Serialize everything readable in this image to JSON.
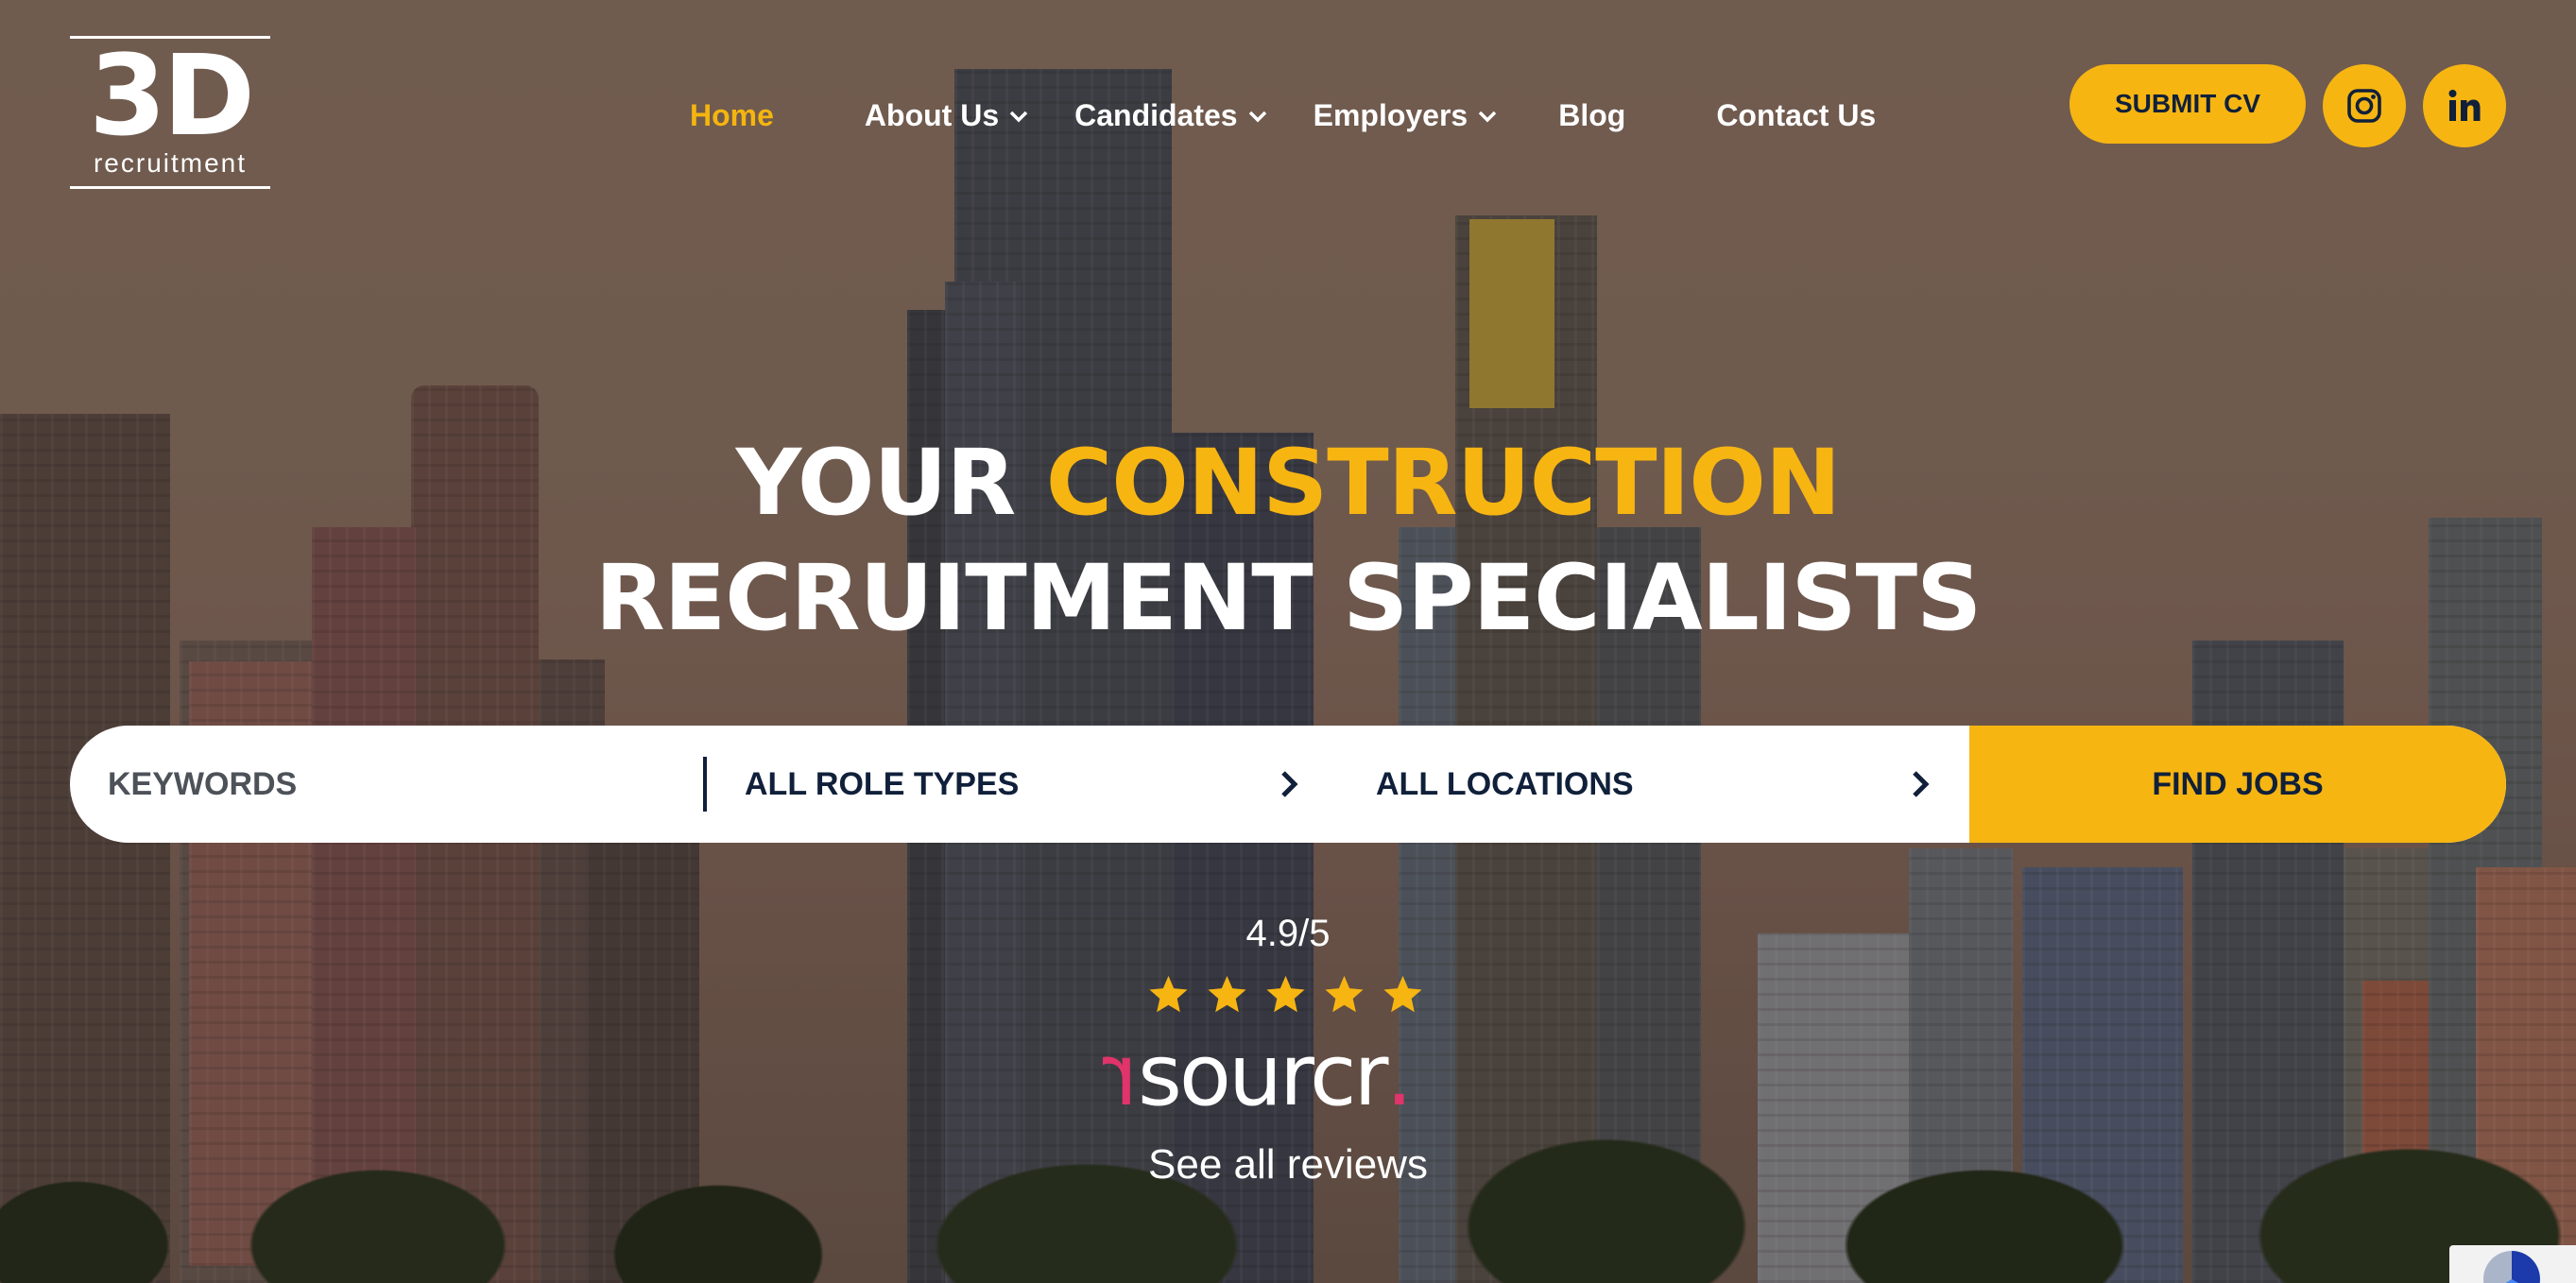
{
  "logo": {
    "mark": "3D",
    "subtitle": "recruitment"
  },
  "nav": {
    "items": [
      {
        "label": "Home",
        "active": true,
        "dropdown": false
      },
      {
        "label": "About Us",
        "active": false,
        "dropdown": true
      },
      {
        "label": "Candidates",
        "active": false,
        "dropdown": true
      },
      {
        "label": "Employers",
        "active": false,
        "dropdown": true
      },
      {
        "label": "Blog",
        "active": false,
        "dropdown": false
      },
      {
        "label": "Contact Us",
        "active": false,
        "dropdown": false
      }
    ]
  },
  "header_actions": {
    "submit_cv": "SUBMIT CV",
    "instagram_icon": "instagram-icon",
    "linkedin_icon": "linkedin-icon"
  },
  "hero": {
    "line1_a": "YOUR ",
    "line1_accent": "CONSTRUCTION",
    "line2": "RECRUITMENT SPECIALISTS"
  },
  "search": {
    "keywords_placeholder": "KEYWORDS",
    "role_types": "ALL ROLE TYPES",
    "locations": "ALL LOCATIONS",
    "button": "FIND JOBS"
  },
  "reviews": {
    "rating": "4.9/5",
    "stars": 5,
    "brand": "sourcr",
    "link": "See all reviews"
  },
  "colors": {
    "accent": "#f7b512",
    "navy": "#10203a",
    "brand_pink": "#e0346a"
  }
}
